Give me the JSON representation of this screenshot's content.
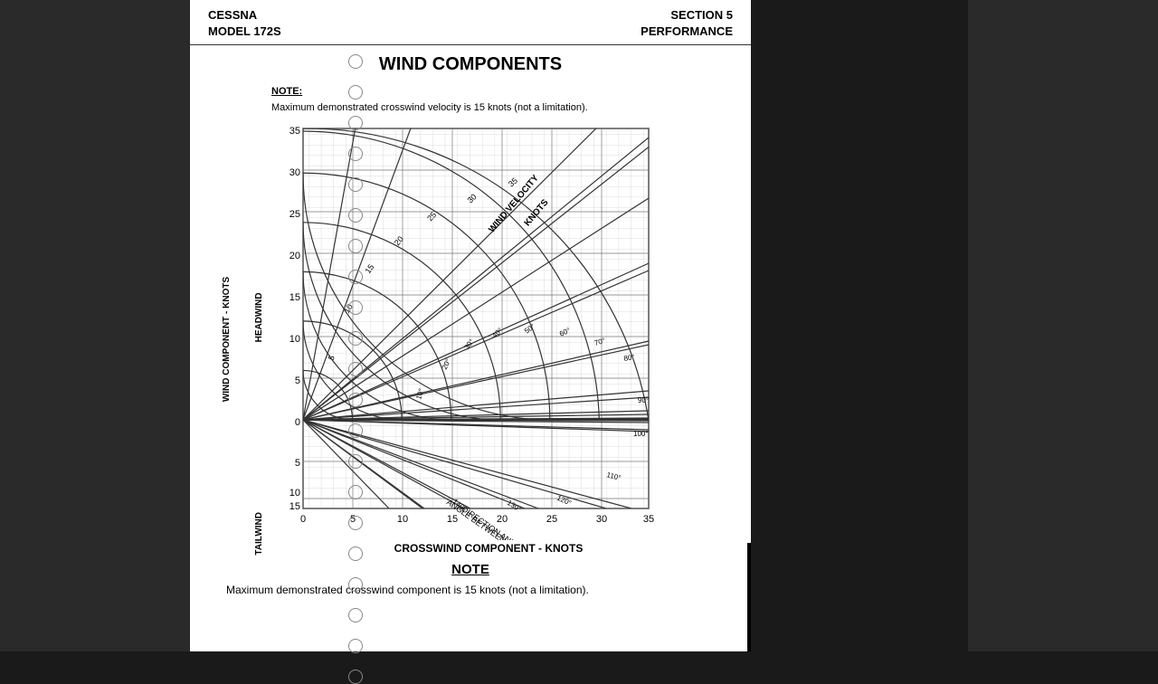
{
  "header": {
    "left_line1": "CESSNA",
    "left_line2": "MODEL 172S",
    "right_line1": "SECTION 5",
    "right_line2": "PERFORMANCE"
  },
  "title": "WIND COMPONENTS",
  "note_top_label": "NOTE:",
  "note_top_text": "Maximum demonstrated crosswind velocity is 15 knots (not a limitation).",
  "chart": {
    "y_axis_label": "WIND COMPONENT - KNOTS",
    "headwind_label": "HEADWIND",
    "tailwind_label": "TAILWIND",
    "x_axis_label": "CROSSWIND COMPONENT - KNOTS",
    "x_ticks": [
      "0",
      "5",
      "10",
      "15",
      "20",
      "25",
      "30",
      "35"
    ],
    "y_ticks_headwind": [
      "35",
      "30",
      "25",
      "20",
      "15",
      "10",
      "5",
      "0"
    ],
    "y_ticks_tailwind": [
      "5",
      "10",
      "15"
    ],
    "wind_velocity_label": "WIND VELOCITY",
    "knots_label": "KNOTS",
    "angle_label": "ANGLE BETWEEN WIND\nDIRECTION AND RUNWAY"
  },
  "bottom_note_title": "NOTE",
  "bottom_note_text": "Maximum demonstrated crosswind component is 15 knots (not a limitation)."
}
